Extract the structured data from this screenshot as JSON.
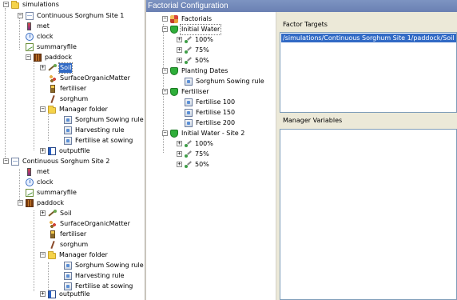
{
  "simulation_tree": {
    "root": "simulations",
    "site1": {
      "label": "Continuous Sorghum Site 1",
      "met": "met",
      "clock": "clock",
      "summaryfile": "summaryfile",
      "paddock": "paddock",
      "soil": "Soil",
      "surface_om": "SurfaceOrganicMatter",
      "fertiliser": "fertiliser",
      "sorghum": "sorghum",
      "manager_folder": "Manager folder",
      "sowing_rule": "Sorghum Sowing rule",
      "harvesting_rule": "Harvesting rule",
      "fertilise_sowing": "Fertilise at sowing",
      "outputfile": "outputfile"
    },
    "site2": {
      "label": "Continuous Sorghum Site 2",
      "met": "met",
      "clock": "clock",
      "summaryfile": "summaryfile",
      "paddock": "paddock",
      "soil": "Soil",
      "surface_om": "SurfaceOrganicMatter",
      "fertiliser": "fertiliser",
      "sorghum": "sorghum",
      "manager_folder": "Manager folder",
      "sowing_rule": "Sorghum Sowing rule",
      "harvesting_rule": "Harvesting rule",
      "fertilise_sowing": "Fertilise at sowing",
      "outputfile": "outputfile"
    }
  },
  "panel": {
    "title": "Factorial Configuration",
    "factor_tree": {
      "root": "Factorials",
      "initial_water": "Initial Water",
      "iw_100": "100%",
      "iw_75": "75%",
      "iw_50": "50%",
      "planting_dates": "Planting Dates",
      "pd_rule": "Sorghum Sowing rule",
      "fertiliser": "Fertiliser",
      "fert_100": "Fertilise 100",
      "fert_150": "Fertilise 150",
      "fert_200": "Fertilise 200",
      "initial_water_2": "Initial Water - Site 2",
      "iw2_100": "100%",
      "iw2_75": "75%",
      "iw2_50": "50%"
    },
    "factor_targets_label": "Factor Targets",
    "factor_targets": [
      "/simulations/Continuous Sorghum Site 1/paddock/Soil"
    ],
    "manager_variables_label": "Manager Variables"
  },
  "colors": {
    "header": "#6f86b8",
    "selection": "#316ac5",
    "panel_bg": "#ece9d8"
  }
}
